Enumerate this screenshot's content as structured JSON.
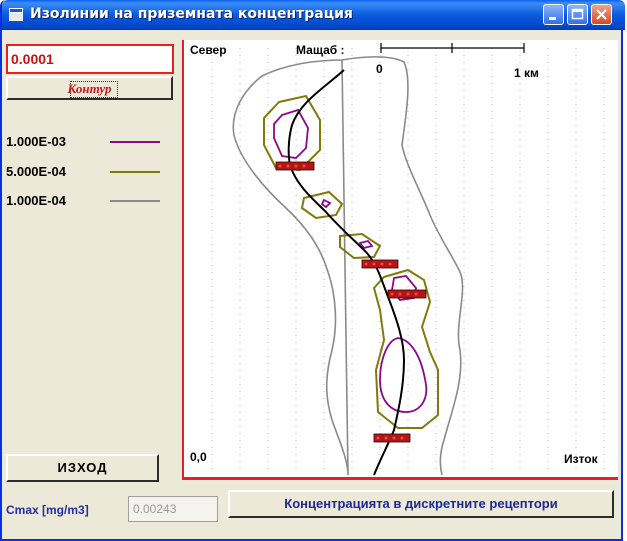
{
  "window": {
    "title": "Изолинии на приземната концентрация"
  },
  "controls": {
    "value": "0.0001",
    "contour_label": "Контур",
    "legend": [
      {
        "label": "1.000E-03",
        "color": "#8b0a8b"
      },
      {
        "label": "5.000E-04",
        "color": "#7f7a0a"
      },
      {
        "label": "1.000E-04",
        "color": "#8a8a8a"
      }
    ],
    "exit_label": "ИЗХОД",
    "cmax_label": "Cmax [mg/m3]",
    "cmax_value": "0.00243",
    "receptors_label": "Концентрацията в дискретните рецептори"
  },
  "plot": {
    "north_label": "Север",
    "scale_label": "Мащаб :",
    "scale_zero": "0",
    "scale_end": "1 км",
    "origin_label": "0,0",
    "east_label": "Изток",
    "accent_color": "#ea2020"
  }
}
